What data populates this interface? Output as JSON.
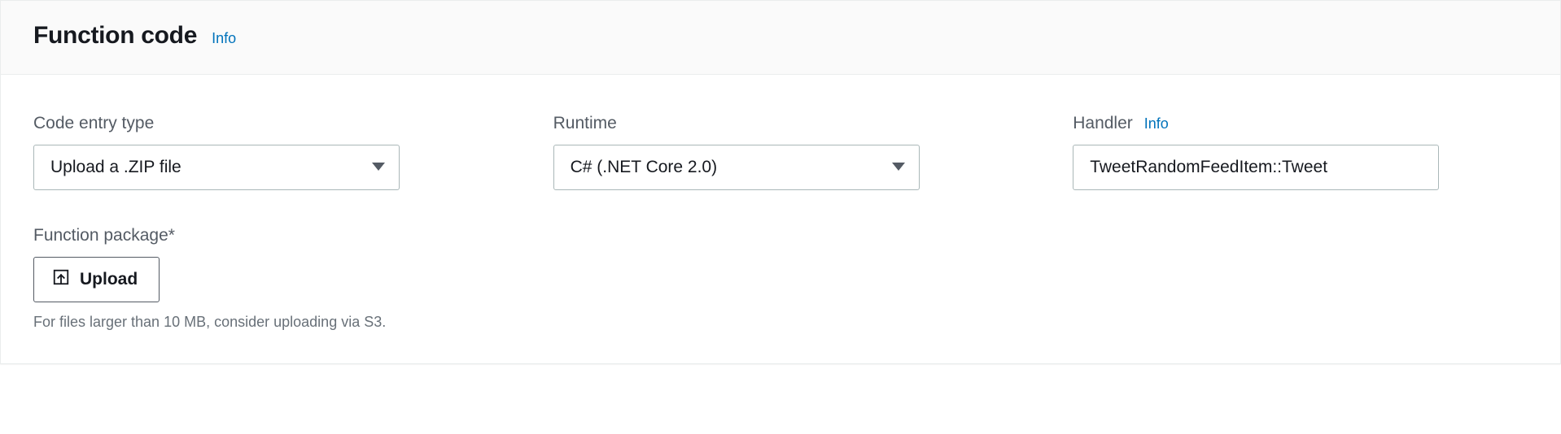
{
  "header": {
    "title": "Function code",
    "info": "Info"
  },
  "fields": {
    "codeEntryType": {
      "label": "Code entry type",
      "value": "Upload a .ZIP file"
    },
    "runtime": {
      "label": "Runtime",
      "value": "C# (.NET Core 2.0)"
    },
    "handler": {
      "label": "Handler",
      "info": "Info",
      "value": "TweetRandomFeedItem::Tweet"
    },
    "functionPackage": {
      "label": "Function package*",
      "button": "Upload",
      "hint": "For files larger than 10 MB, consider uploading via S3."
    }
  }
}
